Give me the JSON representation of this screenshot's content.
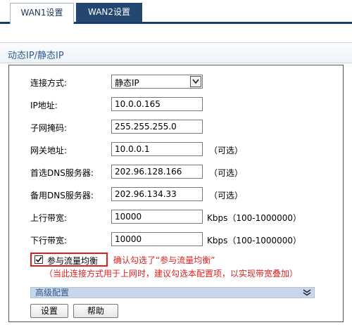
{
  "tabs": [
    {
      "label": "WAN1设置"
    },
    {
      "label": "WAN2设置"
    }
  ],
  "section": {
    "title": "动态IP/静态IP"
  },
  "form": {
    "connection_type": {
      "label": "连接方式:",
      "value": "静态IP"
    },
    "ip": {
      "label": "IP地址:",
      "value": "10.0.0.165"
    },
    "mask": {
      "label": "子网掩码:",
      "value": "255.255.255.0"
    },
    "gateway": {
      "label": "网关地址:",
      "value": "10.0.0.1",
      "hint": "（可选）"
    },
    "dns1": {
      "label": "首选DNS服务器:",
      "value": "202.96.128.166",
      "hint": "（可选）"
    },
    "dns2": {
      "label": "备用DNS服务器:",
      "value": "202.96.134.33",
      "hint": "（可选）"
    },
    "up_bw": {
      "label": "上行带宽:",
      "value": "10000",
      "hint": "Kbps（100-1000000）"
    },
    "down_bw": {
      "label": "下行带宽:",
      "value": "10000",
      "hint": "Kbps（100-1000000）"
    },
    "load_balance": {
      "label": "参与流量均衡",
      "checked": true
    }
  },
  "annotations": {
    "line1": "确认勾选了“参与流量均衡”",
    "line2": "（当此连接方式用于上网时，建议勾选本配置项，以实现带宽叠加）"
  },
  "advanced": {
    "label": "高级配置"
  },
  "buttons": {
    "save": "设置",
    "help": "帮助"
  },
  "colors": {
    "tab_active_bg": "#23476f",
    "annotation": "#e02020",
    "advanced_bar": "#c7d6e8"
  }
}
